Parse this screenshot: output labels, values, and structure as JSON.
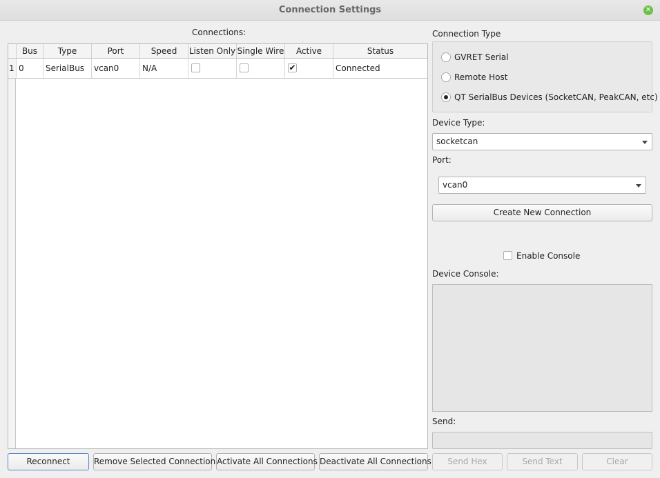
{
  "window": {
    "title": "Connection Settings",
    "close_icon": "close-icon"
  },
  "connections": {
    "title": "Connections:",
    "columns": [
      "Bus",
      "Type",
      "Port",
      "Speed",
      "Listen Only",
      "Single Wire",
      "Active",
      "Status"
    ],
    "rows": [
      {
        "index": "1",
        "bus": "0",
        "type": "SerialBus",
        "port": "vcan0",
        "speed": "N/A",
        "listen_only": false,
        "single_wire": false,
        "active": true,
        "status": "Connected"
      }
    ]
  },
  "connection_type": {
    "label": "Connection Type",
    "options": [
      {
        "label": "GVRET Serial",
        "selected": false
      },
      {
        "label": "Remote Host",
        "selected": false
      },
      {
        "label": "QT SerialBus Devices (SocketCAN, PeakCAN, etc)",
        "selected": true
      }
    ]
  },
  "device_type": {
    "label": "Device Type:",
    "value": "socketcan"
  },
  "port": {
    "label": "Port:",
    "value": "vcan0"
  },
  "create_button": "Create New Connection",
  "enable_console": {
    "label": "Enable Console",
    "checked": false
  },
  "device_console": {
    "label": "Device Console:"
  },
  "send": {
    "label": "Send:",
    "value": ""
  },
  "bottom_buttons": {
    "reconnect": "Reconnect",
    "remove": "Remove Selected Connection",
    "activate_all": "Activate All Connections",
    "deactivate_all": "Deactivate All Connections",
    "send_hex": "Send Hex",
    "send_text": "Send Text",
    "clear": "Clear"
  },
  "colors": {
    "accent": "#5a89c4",
    "close": "#6cc04a"
  }
}
